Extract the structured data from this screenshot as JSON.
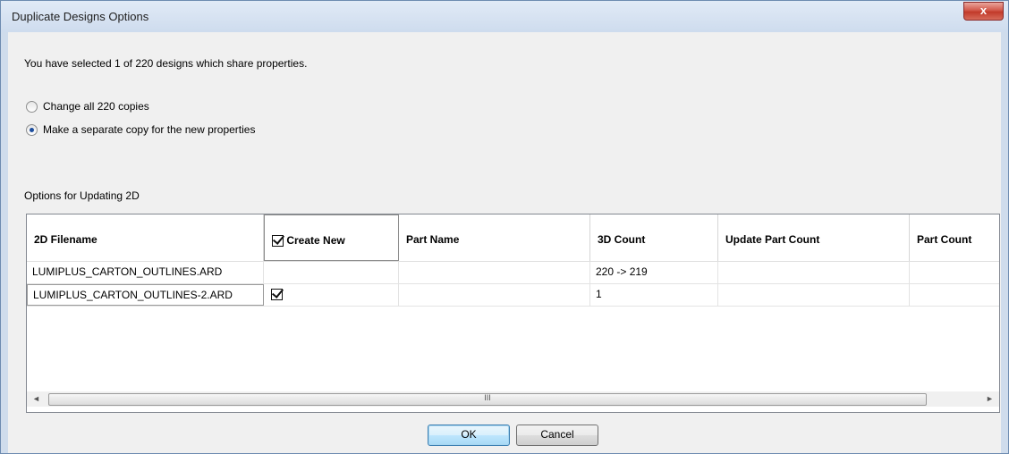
{
  "window": {
    "title": "Duplicate Designs Options",
    "close_label": "x"
  },
  "message": "You have selected 1 of 220 designs which share properties.",
  "radios": [
    {
      "label": "Change all 220 copies",
      "selected": false
    },
    {
      "label": "Make a separate copy for the new properties",
      "selected": true
    }
  ],
  "section_label": "Options for Updating 2D",
  "table": {
    "columns": [
      "2D Filename",
      "Create New",
      "Part Name",
      "3D Count",
      "Update Part Count",
      "Part Count"
    ],
    "rows": [
      {
        "filename": "LUMIPLUS_CARTON_OUTLINES.ARD",
        "create_new": false,
        "part_name": "",
        "count_3d": "220 -> 219",
        "update_part_count": "",
        "part_count": ""
      },
      {
        "filename": "LUMIPLUS_CARTON_OUTLINES-2.ARD",
        "create_new": true,
        "part_name": "",
        "count_3d": "1",
        "update_part_count": "",
        "part_count": ""
      }
    ],
    "scroll_thumb_glyph": "III",
    "scroll_left": "◄",
    "scroll_right": "►"
  },
  "buttons": {
    "ok": "OK",
    "cancel": "Cancel"
  }
}
